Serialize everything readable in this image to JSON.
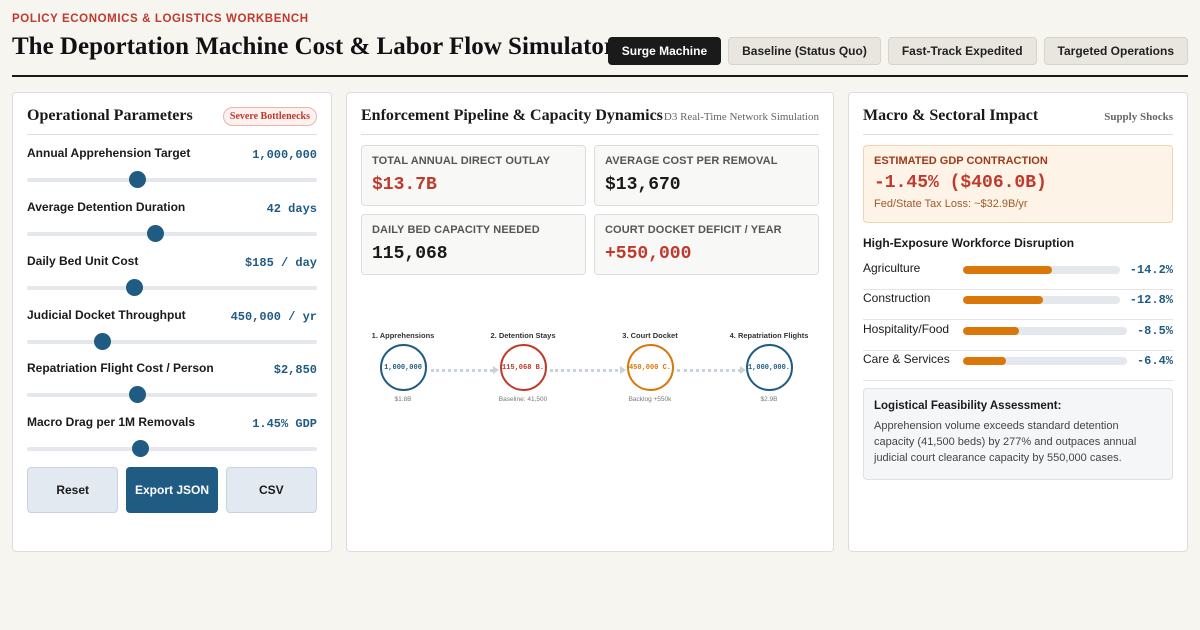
{
  "header": {
    "eyebrow": "POLICY ECONOMICS & LOGISTICS WORKBENCH",
    "title": "The Deportation Machine Cost & Labor Flow Simulator",
    "scenarios": [
      {
        "label": "Surge Machine",
        "active": true
      },
      {
        "label": "Baseline (Status Quo)",
        "active": false
      },
      {
        "label": "Fast-Track Expedited",
        "active": false
      },
      {
        "label": "Targeted Operations",
        "active": false
      }
    ]
  },
  "params_panel": {
    "title": "Operational Parameters",
    "badge": "Severe Bottlenecks",
    "params": [
      {
        "label": "Annual Apprehension Target",
        "value": "1,000,000",
        "level": 0.38
      },
      {
        "label": "Average Detention Duration",
        "value": "42 days",
        "level": 0.44
      },
      {
        "label": "Daily Bed Unit Cost",
        "value": "$185 / day",
        "level": 0.37
      },
      {
        "label": "Judicial Docket Throughput",
        "value": "450,000 / yr",
        "level": 0.26
      },
      {
        "label": "Repatriation Flight Cost / Person",
        "value": "$2,850",
        "level": 0.38
      },
      {
        "label": "Macro Drag per 1M Removals",
        "value": "1.45% GDP",
        "level": 0.39
      }
    ],
    "buttons": {
      "reset": "Reset",
      "export": "Export JSON",
      "csv": "CSV"
    }
  },
  "pipeline_panel": {
    "title": "Enforcement Pipeline & Capacity Dynamics",
    "subtitle": "D3 Real-Time Network Simulation",
    "metrics": [
      {
        "label": "Total Annual Direct Outlay",
        "value": "$13.7B",
        "accent": "red"
      },
      {
        "label": "Average Cost Per Removal",
        "value": "$13,670",
        "accent": "dark"
      },
      {
        "label": "Daily Bed Capacity Needed",
        "value": "115,068",
        "accent": "dark"
      },
      {
        "label": "Court Docket Deficit / Year",
        "value": "+550,000",
        "accent": "red"
      }
    ],
    "nodes": [
      {
        "label": "1. Apprehensions",
        "value": "1,000,000",
        "sub": "$1.8B",
        "color": "#1f5b82"
      },
      {
        "label": "2. Detention Stays",
        "value": "115,068 B.",
        "sub": "Baseline: 41,500",
        "color": "#c0392b"
      },
      {
        "label": "3. Court Docket",
        "value": "450,000 C.",
        "sub": "Backlog +550k",
        "color": "#d9770a"
      },
      {
        "label": "4. Repatriation Flights",
        "value": "1,000,000.",
        "sub": "$2.9B",
        "color": "#1f5b82"
      }
    ]
  },
  "macro_panel": {
    "title": "Macro & Sectoral Impact",
    "subtitle": "Supply Shocks",
    "gdp": {
      "label": "ESTIMATED GDP CONTRACTION",
      "value": "-1.45% ($406.0B)",
      "sub": "Fed/State Tax Loss: ~$32.9B/yr"
    },
    "workforce_title": "High-Exposure Workforce Disruption",
    "workforce": [
      {
        "sector": "Agriculture",
        "value": "-14.2%",
        "level": 0.57
      },
      {
        "sector": "Construction",
        "value": "-12.8%",
        "level": 0.51
      },
      {
        "sector": "Hospitality/Food",
        "value": "-8.5%",
        "level": 0.34
      },
      {
        "sector": "Care & Services",
        "value": "-6.4%",
        "level": 0.26
      }
    ],
    "assessment": {
      "title": "Logistical Feasibility Assessment:",
      "text": "Apprehension volume exceeds standard detention capacity (41,500 beds) by 277% and outpaces annual judicial court clearance capacity by 550,000 cases."
    }
  },
  "colors": {
    "accent_blue": "#1f5b82",
    "alert_red": "#c0392b",
    "warn_orange": "#d9770a"
  }
}
